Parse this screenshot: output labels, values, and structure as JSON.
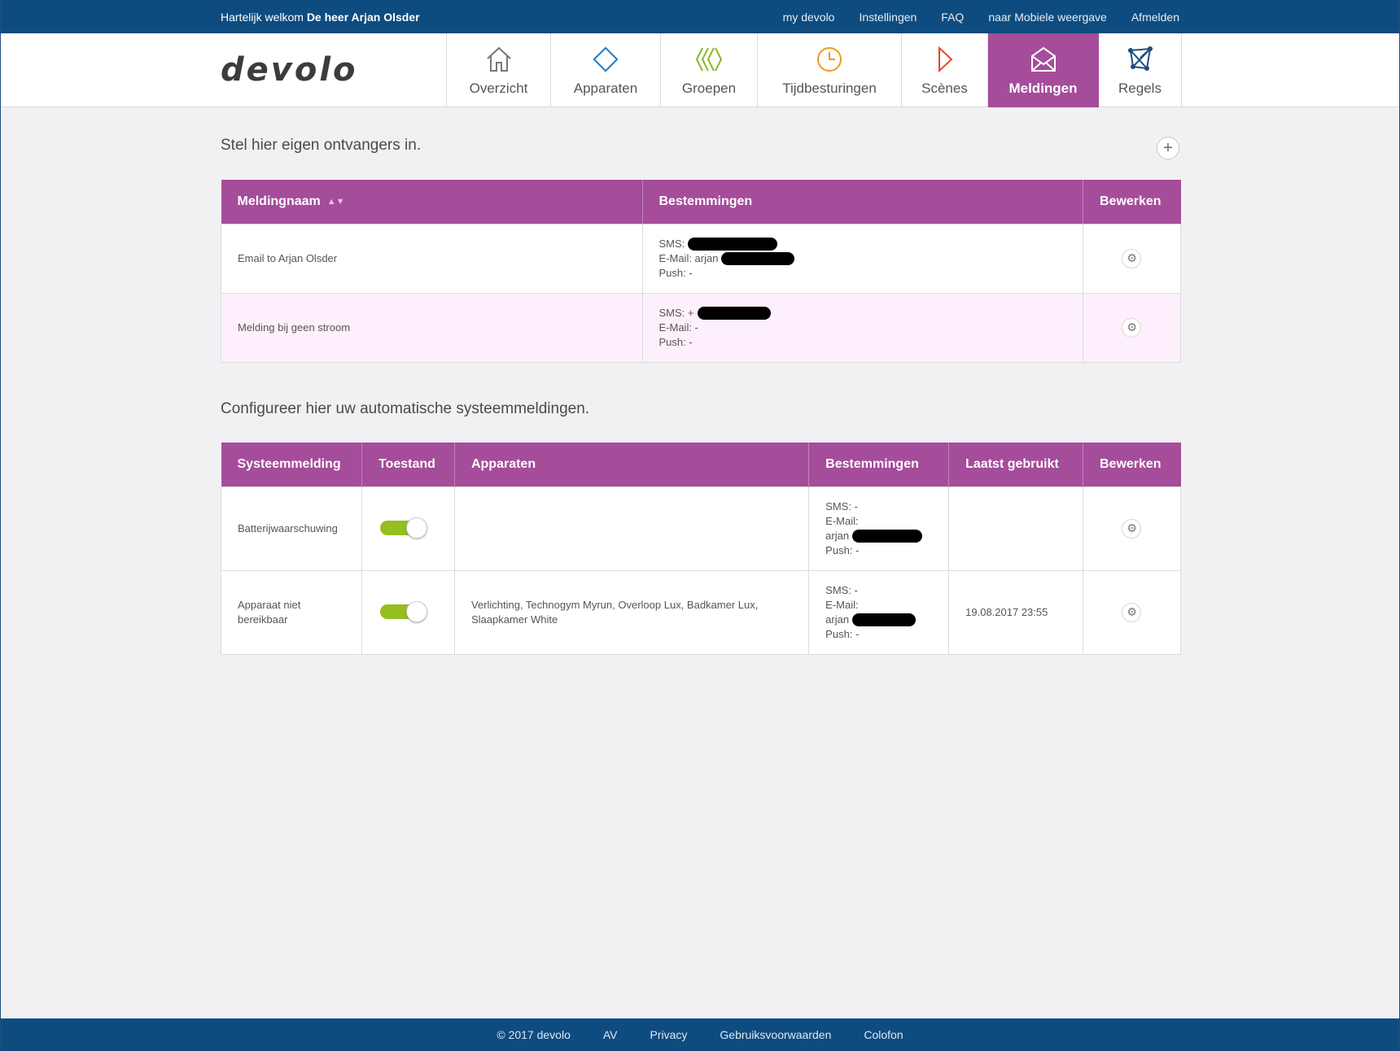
{
  "topbar": {
    "welcome_prefix": "Hartelijk welkom",
    "welcome_name": "De heer Arjan Olsder",
    "links": [
      "my devolo",
      "Instellingen",
      "FAQ",
      "naar Mobiele weergave",
      "Afmelden"
    ]
  },
  "logo": "devolo",
  "nav": [
    {
      "label": "Overzicht",
      "icon": "house-icon"
    },
    {
      "label": "Apparaten",
      "icon": "diamond-icon"
    },
    {
      "label": "Groepen",
      "icon": "groups-icon"
    },
    {
      "label": "Tijdbesturingen",
      "icon": "clock-icon"
    },
    {
      "label": "Scènes",
      "icon": "play-icon"
    },
    {
      "label": "Meldingen",
      "icon": "envelope-icon"
    },
    {
      "label": "Regels",
      "icon": "network-icon"
    }
  ],
  "recipients": {
    "title": "Stel hier eigen ontvangers in.",
    "add_icon": "plus-icon",
    "headers": [
      "Meldingnaam",
      "Bestemmingen",
      "Bewerken"
    ],
    "rows": [
      {
        "name": "Email to Arjan Olsder",
        "sms": "SMS:",
        "email": "E-Mail: arjan",
        "push": "Push: -"
      },
      {
        "name": "Melding bij geen stroom",
        "sms": "SMS: +",
        "email": "E-Mail: -",
        "push": "Push: -"
      }
    ]
  },
  "system": {
    "title": "Configureer hier uw automatische systeemmeldingen.",
    "headers": [
      "Systeemmelding",
      "Toestand",
      "Apparaten",
      "Bestemmingen",
      "Laatst gebruikt",
      "Bewerken"
    ],
    "rows": [
      {
        "name": "Batterijwaarschuwing",
        "enabled": true,
        "devices": "",
        "sms": "SMS: -",
        "email_label": "E-Mail:",
        "email": "arjan",
        "push": "Push: -",
        "last_used": ""
      },
      {
        "name": "Apparaat niet bereikbaar",
        "enabled": true,
        "devices": "Verlichting, Technogym Myrun, Overloop Lux, Badkamer Lux, Slaapkamer White",
        "sms": "SMS: -",
        "email_label": "E-Mail:",
        "email": "arjan",
        "push": "Push: -",
        "last_used": "19.08.2017 23:55"
      }
    ]
  },
  "footer": {
    "copyright": "© 2017 devolo",
    "links": [
      "AV",
      "Privacy",
      "Gebruiksvoorwaarden",
      "Colofon"
    ]
  },
  "colors": {
    "brand_blue": "#0e4c80",
    "accent_purple": "#a54c9a",
    "toggle_green": "#95be1f"
  }
}
